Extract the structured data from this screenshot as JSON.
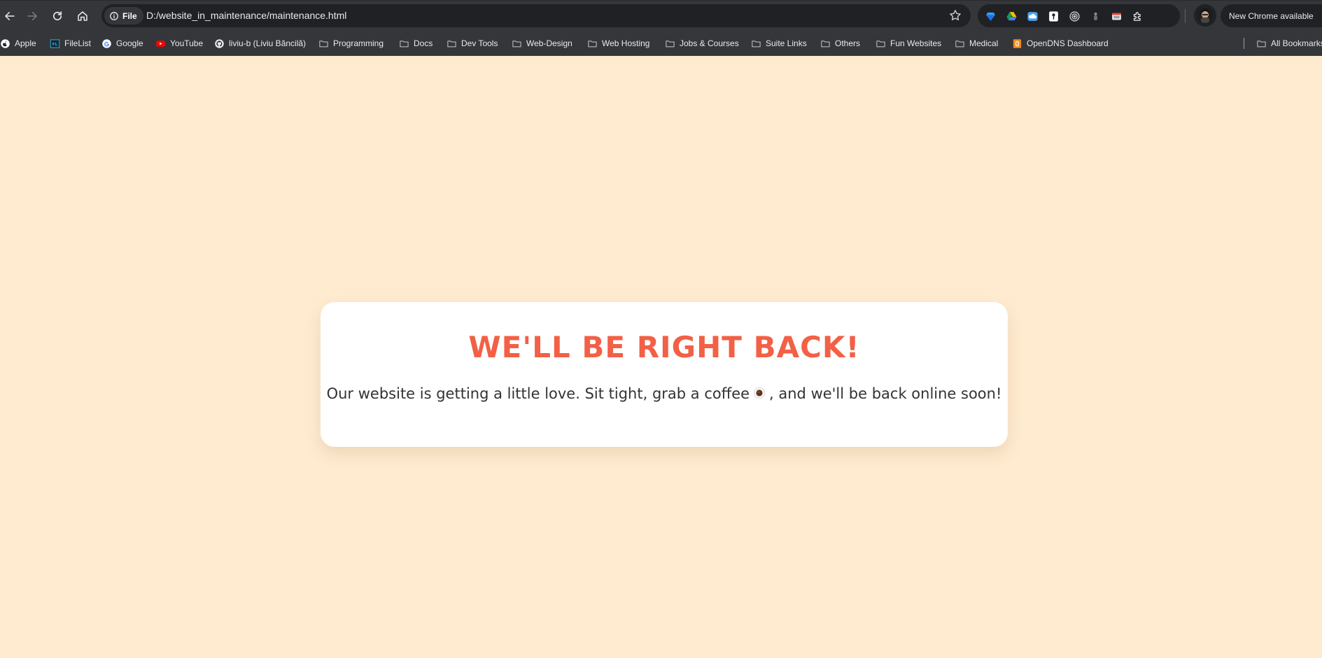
{
  "browser": {
    "site_chip_label": "File",
    "url": "D:/website_in_maintenance/maintenance.html",
    "update_label": "New Chrome available",
    "nav": {
      "back_icon": "arrow-left-icon",
      "forward_icon": "arrow-right-icon",
      "reload_icon": "reload-icon",
      "home_icon": "home-icon"
    },
    "extensions": [
      "gem-extension-icon",
      "google-drive-icon",
      "cloud-extension-icon",
      "password-manager-icon",
      "target-extension-icon",
      "figure-extension-icon",
      "window-extension-icon",
      "puzzle-piece-icon"
    ]
  },
  "bookmarks": {
    "items": [
      {
        "label": "Apple",
        "icon": "apple-icon"
      },
      {
        "label": "FileList",
        "icon": "filelist-icon"
      },
      {
        "label": "Google",
        "icon": "google-icon"
      },
      {
        "label": "YouTube",
        "icon": "youtube-icon"
      },
      {
        "label": "liviu-b (Liviu Băncilă)",
        "icon": "github-icon"
      },
      {
        "label": "Programming",
        "icon": "folder-icon"
      },
      {
        "label": "Docs",
        "icon": "folder-icon"
      },
      {
        "label": "Dev Tools",
        "icon": "folder-icon"
      },
      {
        "label": "Web-Design",
        "icon": "folder-icon"
      },
      {
        "label": "Web Hosting",
        "icon": "folder-icon"
      },
      {
        "label": "Jobs & Courses",
        "icon": "folder-icon"
      },
      {
        "label": "Suite Links",
        "icon": "folder-icon"
      },
      {
        "label": "Others",
        "icon": "folder-icon"
      },
      {
        "label": "Fun Websites",
        "icon": "folder-icon"
      },
      {
        "label": "Medical",
        "icon": "folder-icon"
      },
      {
        "label": "OpenDNS Dashboard",
        "icon": "opendns-icon"
      }
    ],
    "all_bookmarks_label": "All Bookmarks"
  },
  "page": {
    "heading": "WE'LL BE RIGHT BACK!",
    "message_before": "Our website is getting a little love. Sit tight, grab a coffee",
    "message_after": ", and we'll be back online soon!",
    "emoji_icon": "coffee-icon"
  },
  "colors": {
    "page_background": "#feebd0",
    "heading": "#f26046",
    "card": "#ffffff",
    "toolbar": "#35363a"
  }
}
